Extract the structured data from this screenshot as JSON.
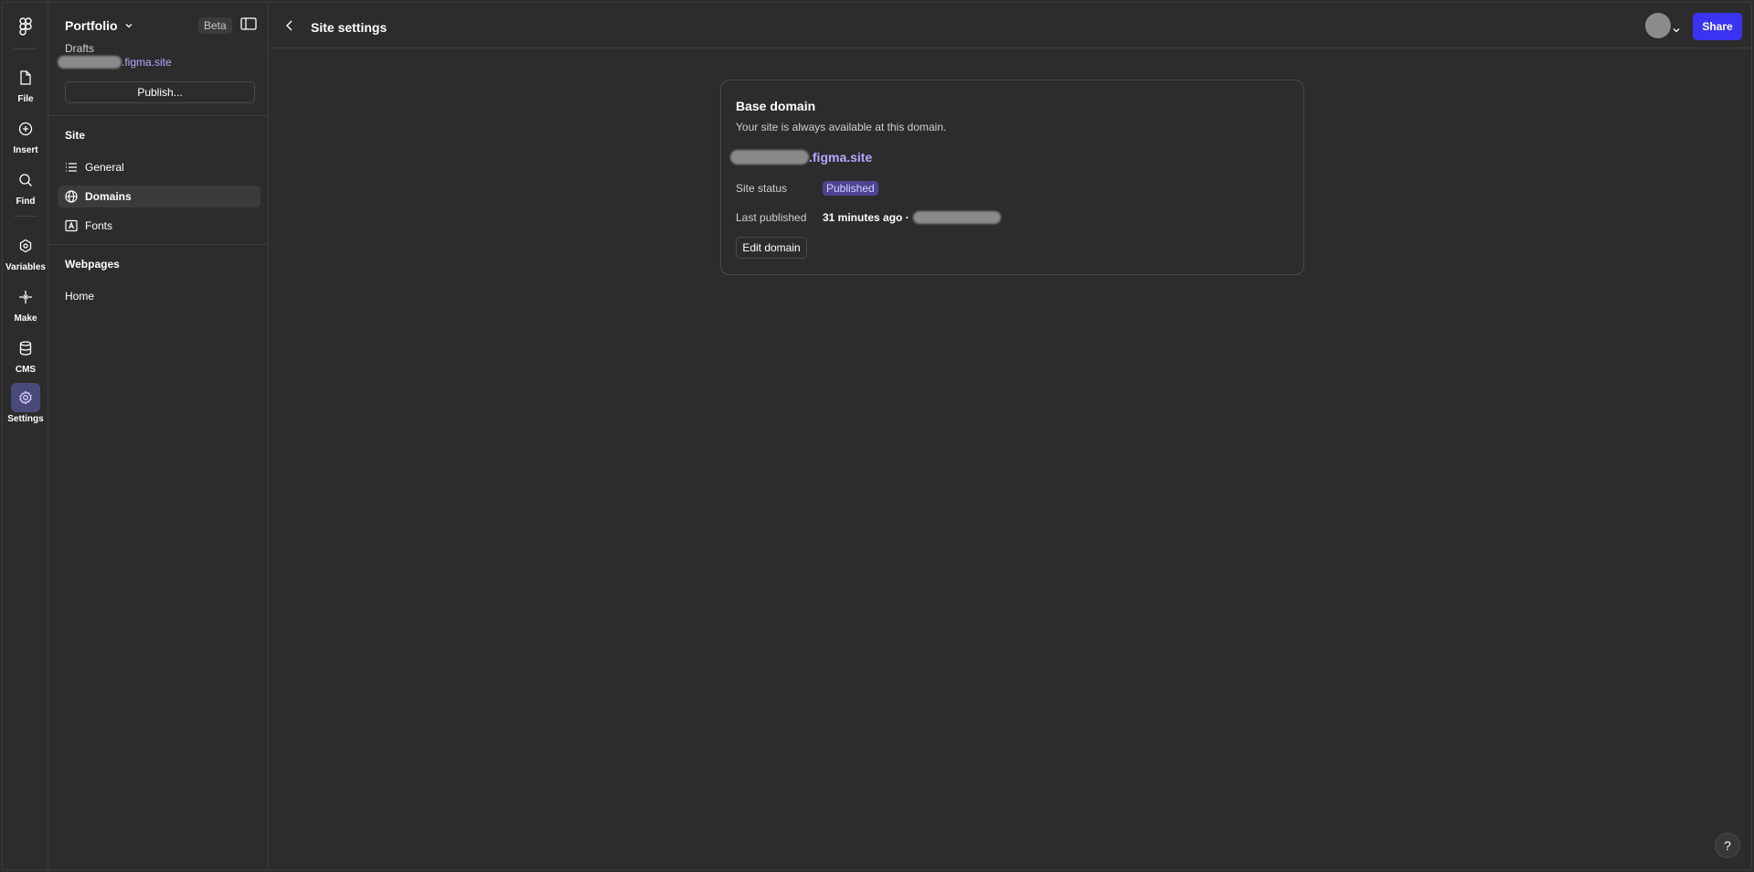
{
  "toolbar": {
    "items": [
      {
        "label": "File",
        "icon": "file-icon"
      },
      {
        "label": "Insert",
        "icon": "plus-circle-icon"
      },
      {
        "label": "Find",
        "icon": "search-icon"
      },
      {
        "label": "Variables",
        "icon": "variables-icon"
      },
      {
        "label": "Make",
        "icon": "sparkle-icon"
      },
      {
        "label": "CMS",
        "icon": "database-icon"
      },
      {
        "label": "Settings",
        "icon": "gear-icon"
      }
    ]
  },
  "panel": {
    "project_name": "Portfolio",
    "beta_label": "Beta",
    "drafts_label": "Drafts",
    "site_url_suffix": ".figma.site",
    "publish_label": "Publish...",
    "site_heading": "Site",
    "site_items": [
      {
        "label": "General",
        "icon": "list-icon"
      },
      {
        "label": "Domains",
        "icon": "globe-icon"
      },
      {
        "label": "Fonts",
        "icon": "font-icon"
      }
    ],
    "webpages_heading": "Webpages",
    "pages": [
      {
        "label": "Home"
      }
    ]
  },
  "header": {
    "title": "Site settings",
    "share_label": "Share"
  },
  "card": {
    "title": "Base domain",
    "description": "Your site is always available at this domain.",
    "domain_suffix": ".figma.site",
    "status_label": "Site status",
    "status_value": "Published",
    "last_published_label": "Last published",
    "last_published_value": "31 minutes ago ·",
    "edit_label": "Edit domain"
  },
  "help_label": "?",
  "colors": {
    "background": "#2c2c2c",
    "accent": "#3a34f2",
    "link": "#b4a9ff",
    "badge_bg": "#4c4490"
  }
}
